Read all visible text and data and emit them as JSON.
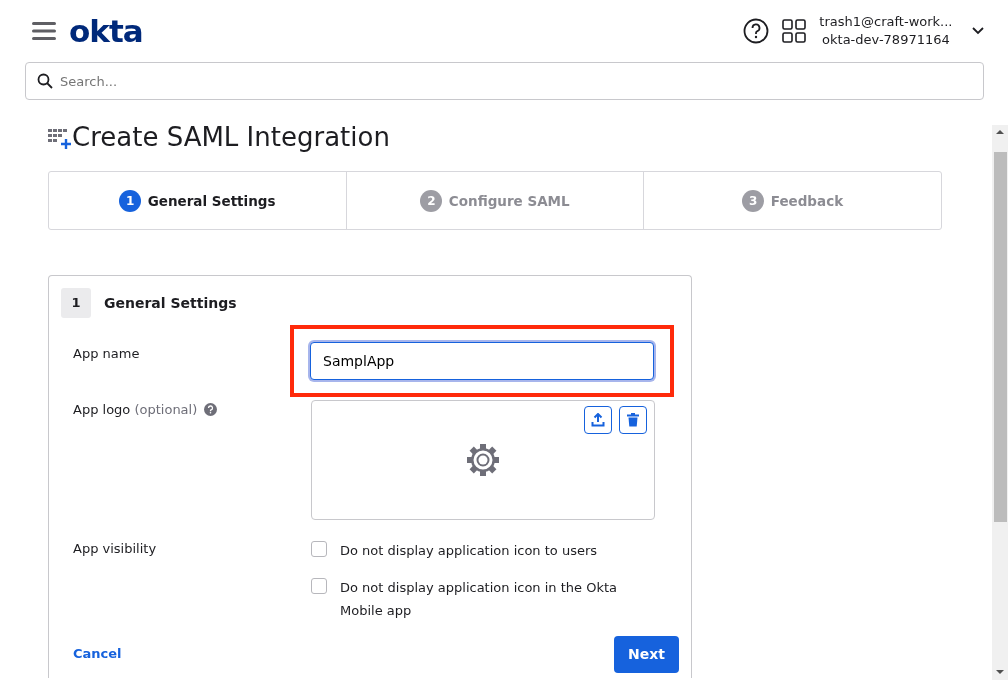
{
  "header": {
    "logo": "okta",
    "user_email": "trash1@craft-work...",
    "org": "okta-dev-78971164"
  },
  "search": {
    "placeholder": "Search..."
  },
  "page": {
    "title": "Create SAML Integration"
  },
  "steps": [
    {
      "number": "1",
      "label": "General Settings",
      "selected": true
    },
    {
      "number": "2",
      "label": "Configure SAML",
      "selected": false
    },
    {
      "number": "3",
      "label": "Feedback",
      "selected": false
    }
  ],
  "form": {
    "step_number": "1",
    "title": "General Settings",
    "app_name": {
      "label": "App name",
      "value": "SamplApp"
    },
    "app_logo": {
      "label": "App logo",
      "hint": "(optional)"
    },
    "app_visibility": {
      "label": "App visibility",
      "options": [
        {
          "label": "Do not display application icon to users",
          "checked": false
        },
        {
          "label": "Do not display application icon in the Okta Mobile app",
          "checked": false
        }
      ]
    },
    "cancel": "Cancel",
    "next": "Next"
  }
}
